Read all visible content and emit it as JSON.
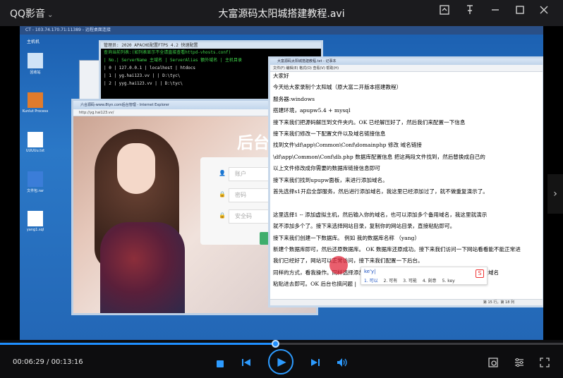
{
  "app": {
    "name": "QQ影音",
    "title": "大富源码太阳城搭建教程.avi"
  },
  "remote": {
    "bar_text": "CT - 103.74.170.71:11389 - 远程桌面连接",
    "desktop_label": "主机机"
  },
  "desktop_icons": [
    {
      "label": "回收站",
      "color": "#cfe3f7"
    },
    {
      "label": "Kunlut Process",
      "color": "#e07b2c"
    },
    {
      "label": "UUUUu.txt",
      "color": "#ffffff"
    },
    {
      "label": "文件包.rar",
      "color": "#3b7dd8"
    },
    {
      "label": "yang1.sql",
      "color": "#ffffff"
    }
  ],
  "cmd": {
    "title": "管理员: 2020 APACHE配置FTPS 4.2 快速配置",
    "lines": [
      {
        "text": "查询当前列表:(如列表显示不全请直接查看httpd-vhosts.conf)",
        "style": "g1"
      },
      {
        "text": "",
        "style": "g2"
      },
      {
        "text": "| No.| ServerName  主域名  | ServerAlias  额外域名 | 主机目录",
        "style": "g1"
      },
      {
        "text": "| 0 | 127.0.0.1     | localhost          | htdocs",
        "style": "g2"
      },
      {
        "text": "| 1 | yg.hai123.vv  |                    | D:\\tyc\\",
        "style": "g2"
      },
      {
        "text": "| 2 | yyg.hai123.vv |                    | D:\\tyc\\",
        "style": "g2"
      }
    ]
  },
  "ie": {
    "title": "六合源码-www.8tyn.com后台管理 - Internet Explorer",
    "address": "http://yg.hai123.vv/",
    "brand": "后台",
    "fields": [
      {
        "icon": "👤",
        "placeholder": "账户"
      },
      {
        "icon": "🔒",
        "placeholder": "密码"
      },
      {
        "icon": "🔒",
        "placeholder": "安全码"
      }
    ],
    "login_label": "登"
  },
  "notepad": {
    "title": "大富源码太阳城搭建教程.txt - 记事本",
    "menu": "文件(F)  编辑(E)  格式(O)  查看(V)  帮助(H)",
    "lines": [
      "大家好",
      "今天给大家录制个太阳城（原大富二开版本搭建教程）",
      "服务器:windows",
      "搭建环境，apupw5.4 + mysql",
      "接下来我们把源码解压到文件夹内。OK 已经解压好了，然后我们来配置一下信息",
      "接下来我们修改一下配置文件以及域名链接信息",
      "找到文件\\df\\app\\Common\\Conf\\domainphp 修改 域名链接",
      "\\df\\app\\Common\\Conf\\db.php  数据库配置信息  把这两段文件找到，然后替换成自己的",
      "以上文件修改成你需要的数据库链接信息即可",
      "接下来我们找到upupw面板，来进行添加域名。",
      "首先选择s1开启全部服务，然后进行添加域名，我这里已经添加过了，就不做重复演示了。",
      "",
      "这里选择1 -- 添加虚拟主机，然后输入你的域名，也可以添加多个备用域名，我这里就演示",
      "就不添加多个了。接下来选择网站目录，复制你的网站目录，直接粘贴即可。",
      "接下来我们创建一下数据库。  例如 我的数据库名称 （yang）",
      "新建个数据库即可，然后还原数据库。 OK 数据库还原成功。接下来我们访问一下网站看看能不能正常进",
      "我们已经好了，网站可以正常访问，接下来我们配置一下后台。",
      "同样的方式，看我操作。同样选择添加主机，然后输入你的后台域名，找到admin的个目录域名",
      "粘贴进去即可。OK 后台也搞问题 |"
    ],
    "status": "第 15 行，第 18 列"
  },
  "ime": {
    "input": "ke'y|",
    "candidates": [
      "1. 可以",
      "2. 可有",
      "3. 可能",
      "4. 刻意",
      "5. key"
    ],
    "logo": "S"
  },
  "playback": {
    "current": "00:06:29",
    "total": "00:13:16",
    "progress": 0.489
  },
  "colors": {
    "accent": "#2d9bff"
  }
}
